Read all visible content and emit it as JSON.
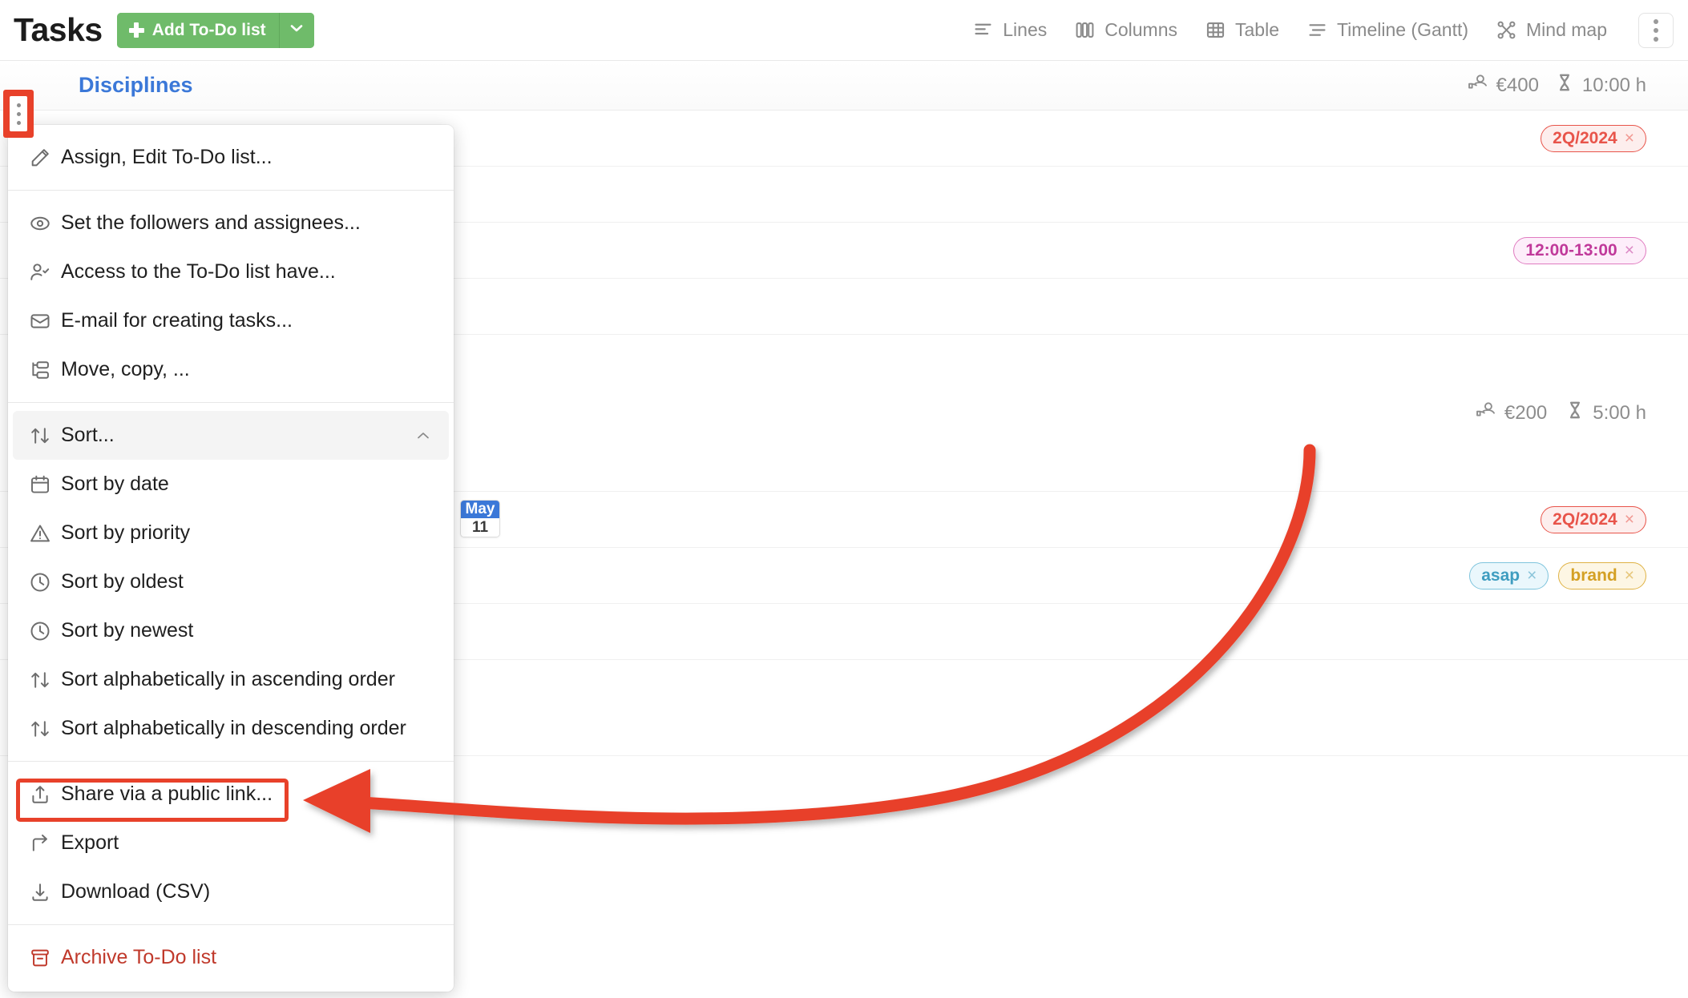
{
  "header": {
    "title": "Tasks",
    "add_button": {
      "label": "Add To-Do list",
      "icon": "plus-icon",
      "caret_icon": "chevron-down-icon",
      "color": "#6fbb6a"
    },
    "view_tabs": [
      {
        "label": "Lines",
        "icon": "lines-view-icon"
      },
      {
        "label": "Columns",
        "icon": "columns-view-icon"
      },
      {
        "label": "Table",
        "icon": "table-view-icon"
      },
      {
        "label": "Timeline (Gantt)",
        "icon": "timeline-gantt-view-icon"
      },
      {
        "label": "Mind map",
        "icon": "mind-map-view-icon"
      }
    ],
    "overflow_icon": "kebab-menu-icon"
  },
  "list": {
    "group": {
      "title": "Disciplines",
      "title_color": "#3b78d8",
      "budget": "€400",
      "budget_icon": "money-hand-icon",
      "duration": "10:00 h",
      "duration_icon": "hourglass-icon"
    },
    "group2": {
      "budget": "€200",
      "budget_icon": "money-hand-icon",
      "duration": "5:00 h",
      "duration_icon": "hourglass-icon"
    },
    "tags": {
      "quarter_1": {
        "label": "2Q/2024",
        "close": "×",
        "color": "#e8544a",
        "bg": "#fdeeed",
        "border": "#e8544a"
      },
      "time_1": {
        "label": "12:00-13:00",
        "close": "×",
        "color": "#c0399a",
        "bg": "#fdeefa",
        "border": "#e07cc0"
      },
      "quarter_2": {
        "label": "2Q/2024",
        "close": "×",
        "color": "#e8544a",
        "bg": "#fdeeed",
        "border": "#e8544a"
      },
      "asap": {
        "label": "asap",
        "close": "×",
        "color": "#3f9dc0",
        "bg": "#eaf7fc",
        "border": "#7ec4dc"
      },
      "brand": {
        "label": "brand",
        "close": "×",
        "color": "#d4a024",
        "bg": "#fdf6e4",
        "border": "#dfb244"
      }
    },
    "date_chip": {
      "month": "May",
      "day": "11"
    }
  },
  "menu": {
    "trigger_icon": "vertical-dots-icon",
    "trigger_color": "#e8412a",
    "sections": [
      {
        "items": [
          {
            "label": "Assign, Edit To-Do list...",
            "icon": "pencil-icon"
          }
        ]
      },
      {
        "items": [
          {
            "label": "Set the followers and assignees...",
            "icon": "eye-icon"
          },
          {
            "label": "Access to the To-Do list have...",
            "icon": "user-check-icon"
          },
          {
            "label": "E-mail for creating tasks...",
            "icon": "envelope-icon"
          },
          {
            "label": "Move, copy, ...",
            "icon": "move-copy-icon"
          }
        ]
      },
      {
        "items": [
          {
            "label": "Sort...",
            "icon": "sort-arrows-icon",
            "state": "expanded",
            "chevron": "chevron-up-icon"
          },
          {
            "label": "Sort by date",
            "icon": "calendar-icon"
          },
          {
            "label": "Sort by priority",
            "icon": "warning-triangle-icon"
          },
          {
            "label": "Sort by oldest",
            "icon": "clock-icon"
          },
          {
            "label": "Sort by newest",
            "icon": "clock-icon"
          },
          {
            "label": "Sort alphabetically in ascending order",
            "icon": "sort-arrows-icon"
          },
          {
            "label": "Sort alphabetically in descending order",
            "icon": "sort-arrows-icon"
          }
        ]
      },
      {
        "items": [
          {
            "label": "Share via a public link...",
            "icon": "share-upload-icon",
            "highlighted": true
          },
          {
            "label": "Export",
            "icon": "export-arrow-icon"
          },
          {
            "label": "Download (CSV)",
            "icon": "download-icon"
          }
        ]
      },
      {
        "items": [
          {
            "label": "Archive To-Do list",
            "icon": "archive-box-icon",
            "danger": true,
            "color": "#c0392b"
          }
        ]
      }
    ]
  },
  "annotation": {
    "arrow_color": "#e8412a",
    "highlight_target": "Share via a public link..."
  }
}
